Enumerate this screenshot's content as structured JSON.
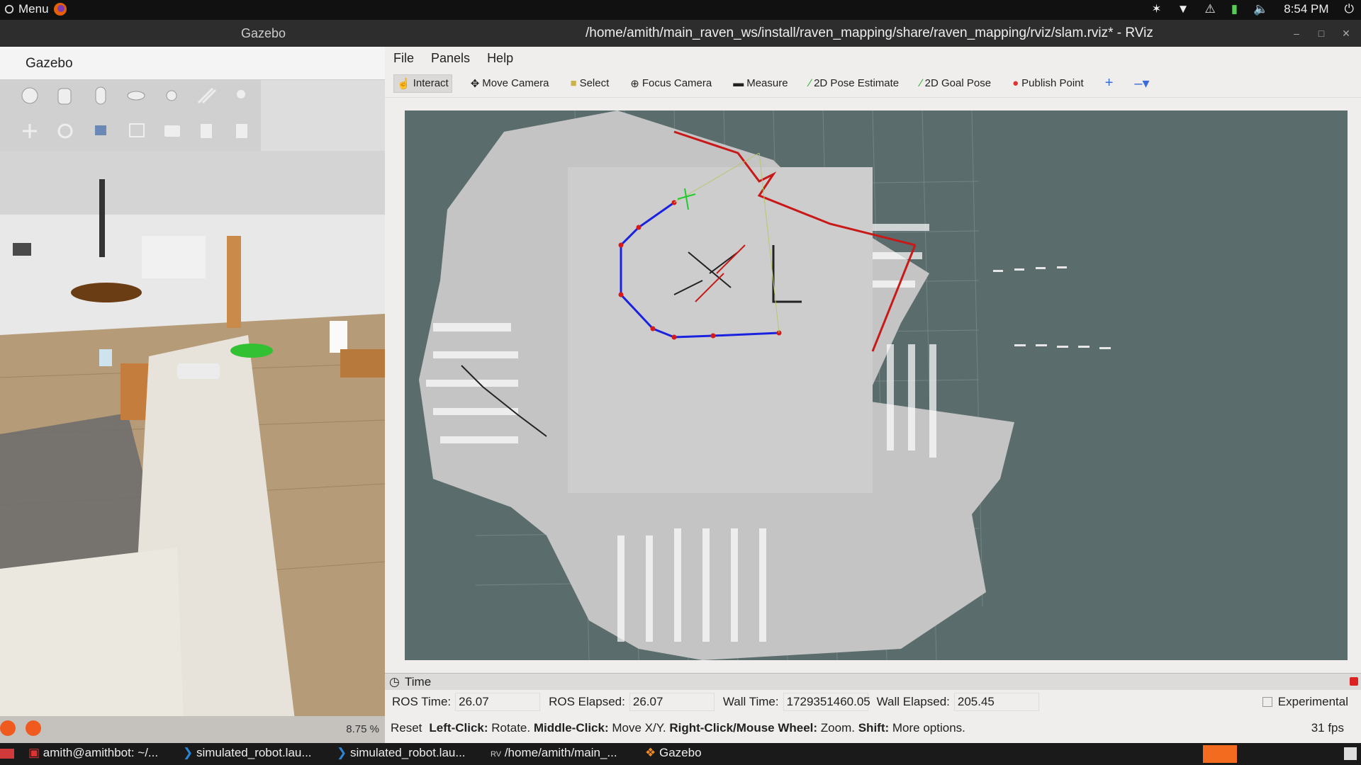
{
  "topbar": {
    "menu": "Menu",
    "clock": "8:54 PM"
  },
  "gazebo": {
    "window_title": "Gazebo",
    "header": "Gazebo",
    "zoom": "8.75 %"
  },
  "rviz": {
    "window_title": "/home/amith/main_raven_ws/install/raven_mapping/share/raven_mapping/rviz/slam.rviz* - RViz",
    "menus": [
      "File",
      "Panels",
      "Help"
    ],
    "tools": [
      "Interact",
      "Move Camera",
      "Select",
      "Focus Camera",
      "Measure",
      "2D Pose Estimate",
      "2D Goal Pose",
      "Publish Point"
    ],
    "time_panel": {
      "title": "Time",
      "ros_time_label": "ROS Time:",
      "ros_time": "26.07",
      "ros_elapsed_label": "ROS Elapsed:",
      "ros_elapsed": "26.07",
      "wall_time_label": "Wall Time:",
      "wall_time": "1729351460.05",
      "wall_elapsed_label": "Wall Elapsed:",
      "wall_elapsed": "205.45",
      "experimental": "Experimental"
    },
    "hint": {
      "reset": "Reset",
      "lc": "Left-Click:",
      "lc_t": "Rotate.",
      "mc": "Middle-Click:",
      "mc_t": "Move X/Y.",
      "rc": "Right-Click/Mouse Wheel:",
      "rc_t": "Zoom.",
      "sh": "Shift:",
      "sh_t": "More options.",
      "fps": "31 fps"
    }
  },
  "taskbar": {
    "items": [
      "amith@amithbot: ~/...",
      "simulated_robot.lau...",
      "simulated_robot.lau...",
      "/home/amith/main_...",
      "Gazebo"
    ]
  }
}
